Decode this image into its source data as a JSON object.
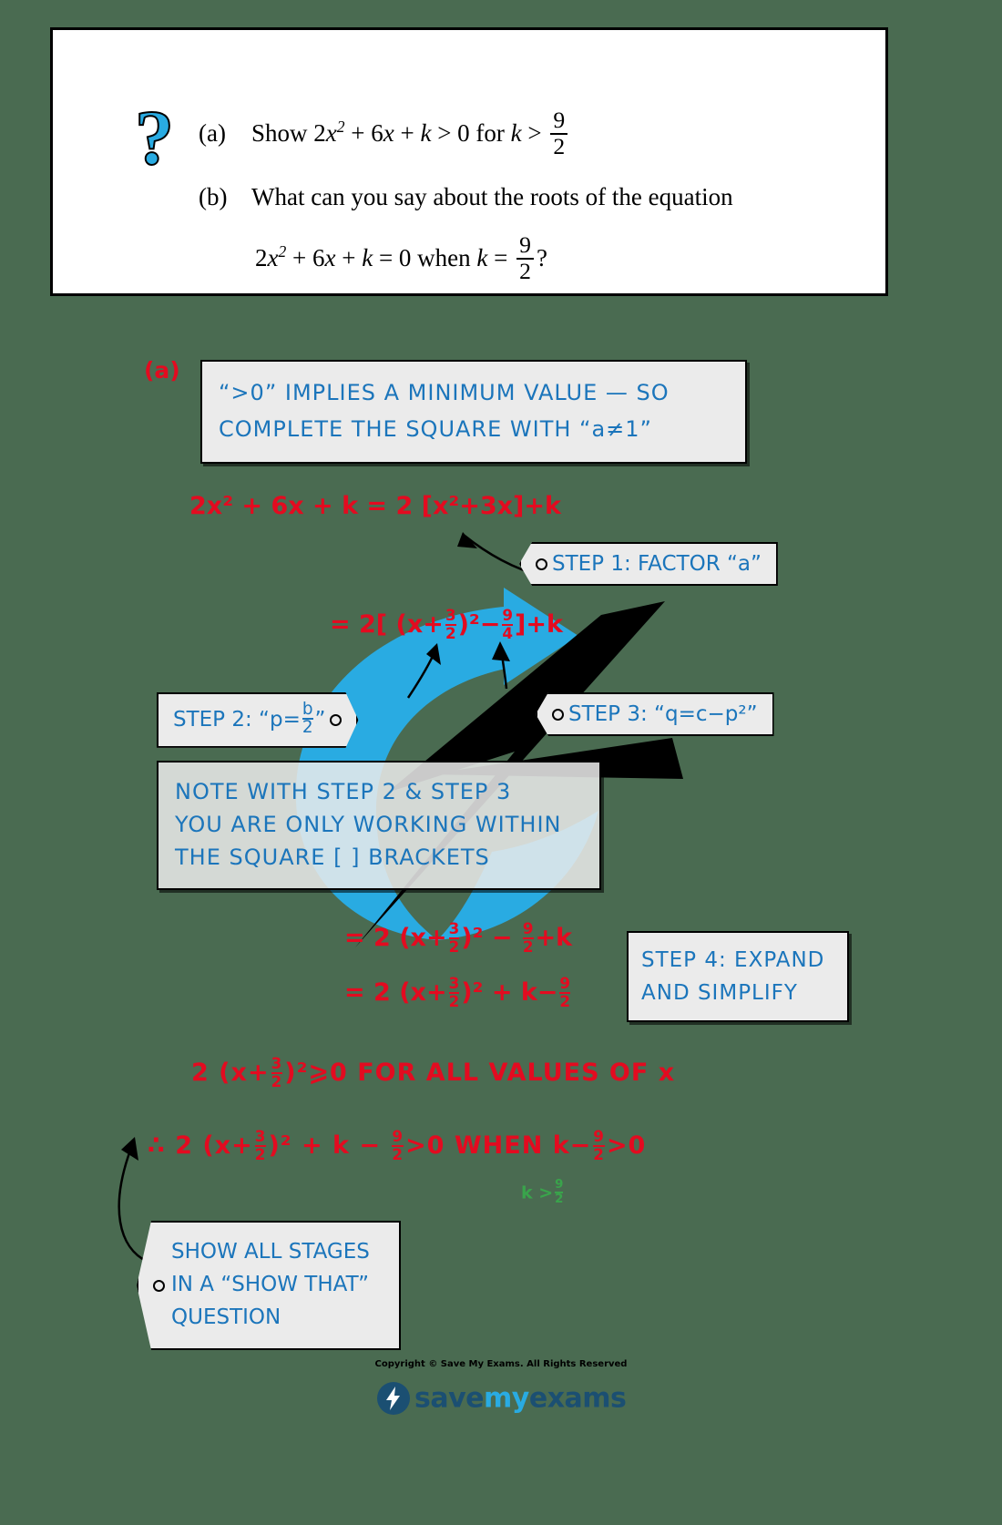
{
  "question": {
    "icon": "question-mark-icon",
    "part_a": {
      "label": "(a)",
      "text_before": "Show",
      "expr": "2x2 + 6x + k > 0 for k >",
      "fraction": {
        "num": "9",
        "den": "2"
      }
    },
    "part_b": {
      "label": "(b)",
      "line1": "What can you say about the roots of the equation",
      "line2_before": "2x2 + 6x + k = 0 when k =",
      "fraction": {
        "num": "9",
        "den": "2"
      },
      "line2_after": "?"
    }
  },
  "part_label": "(a)",
  "hint_a": {
    "line1": "“>0”  IMPLIES   A   MINIMUM   VALUE  —  SO",
    "line2": "COMPLETE   THE   SQUARE   WITH   “a≠1”"
  },
  "note_box": {
    "line1": "NOTE   WITH   STEP 2  &   STEP 3",
    "line2": "YOU   ARE   ONLY   WORKING   WITHIN",
    "line3": "THE   SQUARE   [ ]   BRACKETS"
  },
  "tags": {
    "step1": "STEP  1:  FACTOR  “a”",
    "step2_prefix": "STEP  2:  “p=",
    "step2_frac": {
      "num": "b",
      "den": "2"
    },
    "step2_suffix": "”",
    "step3": "STEP  3:  “q=c−p²”",
    "step4_line1": "STEP  4: EXPAND",
    "step4_line2": "AND   SIMPLIFY",
    "show_line1": "SHOW   ALL   STAGES",
    "show_line2": "IN  A  “SHOW  THAT”",
    "show_line3": "QUESTION"
  },
  "working": {
    "line1": {
      "lhs": "2x² + 6x + k = 2 [x²+3x]+k"
    },
    "line2": {
      "prefix": "= 2[ (x+",
      "frac1": {
        "num": "3",
        "den": "2"
      },
      "mid": ")²−",
      "frac2": {
        "num": "9",
        "den": "4"
      },
      "suffix": "]+k"
    },
    "line3": {
      "prefix": "= 2 (x+",
      "frac1": {
        "num": "3",
        "den": "2"
      },
      "mid": ")² − ",
      "frac2": {
        "num": "9",
        "den": "2"
      },
      "suffix": "+k"
    },
    "line4": {
      "prefix": "= 2 (x+",
      "frac1": {
        "num": "3",
        "den": "2"
      },
      "mid": ")² + k−",
      "frac2": {
        "num": "9",
        "den": "2"
      },
      "suffix": ""
    },
    "line5": {
      "prefix": "2 (x+",
      "frac1": {
        "num": "3",
        "den": "2"
      },
      "suffix": ")²⩾0    FOR  ALL  VALUES  OF  x"
    },
    "line6": {
      "therefore": "∴",
      "prefix": "2 (x+",
      "frac1": {
        "num": "3",
        "den": "2"
      },
      "mid": ")² + k − ",
      "frac2": {
        "num": "9",
        "den": "2"
      },
      "mid2": ">0  WHEN  k−",
      "frac3": {
        "num": "9",
        "den": "2"
      },
      "suffix": ">0"
    },
    "green": {
      "prefix": "k >",
      "frac": {
        "num": "9",
        "den": "2"
      }
    }
  },
  "footer": {
    "copyright": "Copyright © Save My Exams. All Rights Reserved",
    "logo_save": "save",
    "logo_my": "my",
    "logo_exams": "exams"
  },
  "colors": {
    "background": "#4a6b51",
    "working_red": "#e30b20",
    "hint_blue": "#1b75bb",
    "swoosh_blue": "#29abe2",
    "green": "#35b44a"
  }
}
